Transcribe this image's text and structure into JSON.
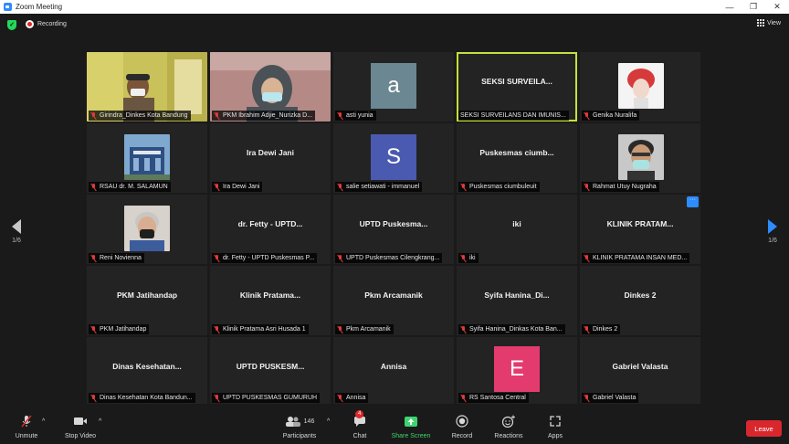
{
  "window": {
    "title": "Zoom Meeting",
    "controls": [
      "—",
      "❐",
      "✕"
    ]
  },
  "meeting": {
    "recording_label": "Recording",
    "view_label": "View"
  },
  "nav": {
    "left_page": "1/6",
    "right_page": "1/6"
  },
  "tiles": [
    {
      "label": "Girindra_Dinkes Kota Bandung",
      "center": "",
      "avatar": "",
      "avatar_color": "",
      "has_video": true
    },
    {
      "label": "PKM Ibrahim Adjie_Nurizka D...",
      "center": "",
      "avatar": "",
      "avatar_color": "",
      "has_video": true
    },
    {
      "label": "asti yunia",
      "center": "",
      "avatar": "a",
      "avatar_color": "#6b8791",
      "has_video": false
    },
    {
      "label": "SEKSI SURVEILANS DAN IMUNIS...",
      "center": "SEKSI SURVEILA...",
      "avatar": "",
      "avatar_color": "",
      "has_video": false
    },
    {
      "label": "Genika Nuralifa",
      "center": "",
      "avatar": "",
      "avatar_color": "",
      "has_video": true
    },
    {
      "label": "RSAU dr. M. SALAMUN",
      "center": "",
      "avatar": "",
      "avatar_color": "",
      "has_video": true
    },
    {
      "label": "Ira Dewi Jani",
      "center": "Ira Dewi Jani",
      "avatar": "",
      "avatar_color": "",
      "has_video": false
    },
    {
      "label": "salie setiawati - immanuel",
      "center": "",
      "avatar": "S",
      "avatar_color": "#4a5ab0",
      "has_video": false
    },
    {
      "label": "Puskesmas ciumbuleuit",
      "center": "Puskesmas ciumb...",
      "avatar": "",
      "avatar_color": "",
      "has_video": false
    },
    {
      "label": "Rahmat Utuy Nugraha",
      "center": "",
      "avatar": "",
      "avatar_color": "",
      "has_video": true
    },
    {
      "label": "Reni Novienna",
      "center": "",
      "avatar": "",
      "avatar_color": "",
      "has_video": true
    },
    {
      "label": "dr. Fetty - UPTD Puskesmas P...",
      "center": "dr. Fetty - UPTD...",
      "avatar": "",
      "avatar_color": "",
      "has_video": false
    },
    {
      "label": "UPTD Puskesmas Cilengkrang...",
      "center": "UPTD Puskesma...",
      "avatar": "",
      "avatar_color": "",
      "has_video": false
    },
    {
      "label": "iki",
      "center": "iki",
      "avatar": "",
      "avatar_color": "",
      "has_video": false
    },
    {
      "label": "KLINIK PRATAMA INSAN MED...",
      "center": "KLINIK PRATAM...",
      "avatar": "",
      "avatar_color": "",
      "has_video": false,
      "more": "···"
    },
    {
      "label": "PKM Jatihandap",
      "center": "PKM Jatihandap",
      "avatar": "",
      "avatar_color": "",
      "has_video": false
    },
    {
      "label": "Klinik Pratama Asri Husada 1",
      "center": "Klinik Pratama...",
      "avatar": "",
      "avatar_color": "",
      "has_video": false
    },
    {
      "label": "Pkm Arcamanik",
      "center": "Pkm Arcamanik",
      "avatar": "",
      "avatar_color": "",
      "has_video": false
    },
    {
      "label": "Syifa Hanina_Dinkas Kota Ban...",
      "center": "Syifa Hanina_Di...",
      "avatar": "",
      "avatar_color": "",
      "has_video": false
    },
    {
      "label": "Dinkes 2",
      "center": "Dinkes 2",
      "avatar": "",
      "avatar_color": "",
      "has_video": false
    },
    {
      "label": "Dinas Kesehatan Kota Bandun...",
      "center": "Dinas Kesehatan...",
      "avatar": "",
      "avatar_color": "",
      "has_video": false
    },
    {
      "label": "UPTD PUSKESMAS GUMURUH",
      "center": "UPTD PUSKESM...",
      "avatar": "",
      "avatar_color": "",
      "has_video": false
    },
    {
      "label": "Annisa",
      "center": "Annisa",
      "avatar": "",
      "avatar_color": "",
      "has_video": false
    },
    {
      "label": "RS Santosa Central",
      "center": "",
      "avatar": "E",
      "avatar_color": "#e43b6e",
      "has_video": false
    },
    {
      "label": "Gabriel Valasta",
      "center": "Gabriel Valasta",
      "avatar": "",
      "avatar_color": "",
      "has_video": false
    }
  ],
  "toolbar": {
    "unmute": "Unmute",
    "stop_video": "Stop Video",
    "participants": "Participants",
    "participants_count": "146",
    "chat": "Chat",
    "chat_badge": "4",
    "share_screen": "Share Screen",
    "record": "Record",
    "reactions": "Reactions",
    "apps": "Apps",
    "leave": "Leave",
    "caret": "^"
  },
  "colors": {
    "active_speaker": "#c7e03a",
    "leave": "#d9272e",
    "share": "#3dd56d",
    "accent": "#2d8cff"
  }
}
